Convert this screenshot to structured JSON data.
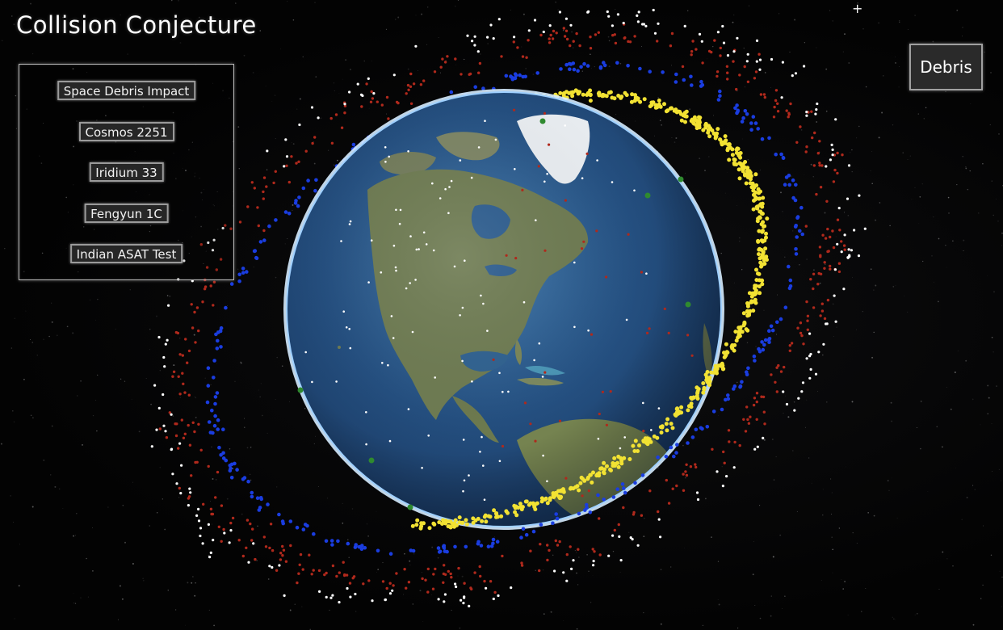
{
  "app": {
    "title": "Collision Conjecture"
  },
  "event_panel": {
    "buttons": [
      {
        "label": "Space Debris Impact"
      },
      {
        "label": "Cosmos 2251"
      },
      {
        "label": "Iridium 33"
      },
      {
        "label": "Fengyun 1C"
      },
      {
        "label": "Indian ASAT Test"
      }
    ]
  },
  "view_toggle": {
    "label": "Debris"
  },
  "cursor_glyph": "+",
  "colors": {
    "background": "#050505",
    "debris_yellow": "#f2e233",
    "debris_blue": "#1a3de0",
    "debris_red": "#b0291c",
    "debris_white": "#ffffff",
    "debris_green": "#2f8a2f",
    "ocean": "#2a5a8c",
    "land": "#6f7d55",
    "ice": "#e8ecf0",
    "atmosphere": "#bfe0ff"
  },
  "globe_icon": "earth-globe"
}
